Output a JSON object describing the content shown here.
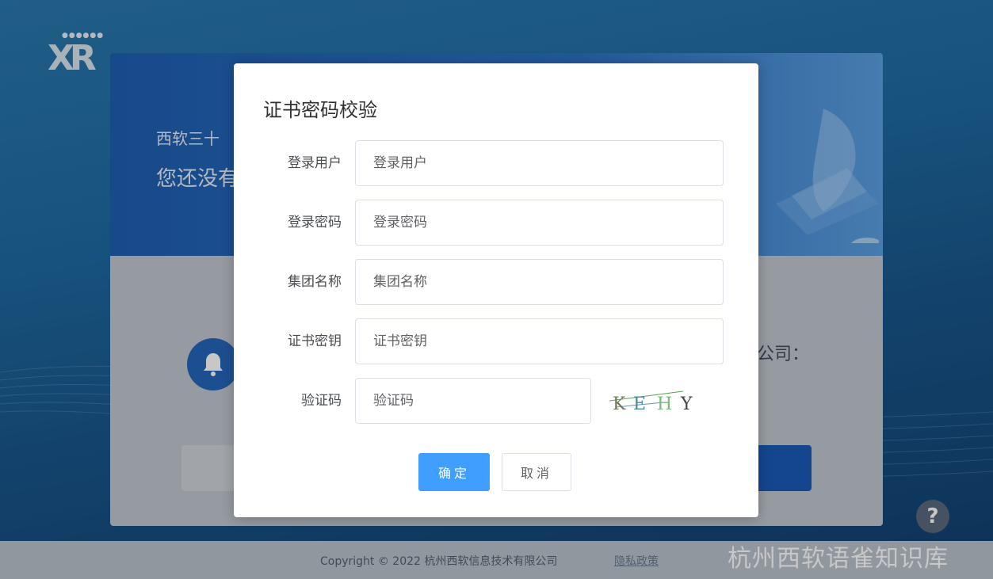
{
  "background_card": {
    "line1": "西软三十",
    "line2": "您还没有",
    "company_suffix": "公司："
  },
  "help": {
    "label": "?"
  },
  "footer": {
    "copyright": "Copyright © 2022 杭州西软信息技术有限公司",
    "privacy_link": "隐私政策"
  },
  "watermark": "杭州西软语雀知识库",
  "modal": {
    "title": "证书密码校验",
    "fields": [
      {
        "label": "登录用户",
        "placeholder": "登录用户"
      },
      {
        "label": "登录密码",
        "placeholder": "登录密码"
      },
      {
        "label": "集团名称",
        "placeholder": "集团名称"
      },
      {
        "label": "证书密钥",
        "placeholder": "证书密钥"
      },
      {
        "label": "验证码",
        "placeholder": "验证码"
      }
    ],
    "captcha": [
      "K",
      "E",
      "H",
      "Y"
    ],
    "confirm_label": "确定",
    "cancel_label": "取消"
  },
  "colors": {
    "primary": "#409eff",
    "background": "#1d5f95",
    "card_header": "#1f5fb0"
  }
}
